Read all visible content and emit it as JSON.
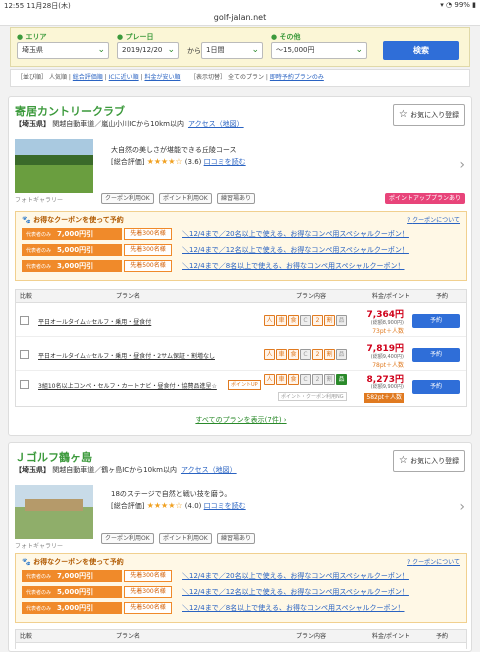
{
  "status": {
    "time": "12:55",
    "date": "11月28日(木)",
    "battery": "99%"
  },
  "url": "golf-jalan.net",
  "search": {
    "area_label": "エリア",
    "area_value": "埼玉県",
    "date_label": "プレー日",
    "date_value": "2019/12/20",
    "kara": "から",
    "days_value": "1日間",
    "other_label": "その他",
    "other_value": "〜15,000円",
    "search_button": "検索"
  },
  "sort": {
    "prefix": "［並び順］",
    "current": "人気順",
    "options": [
      "総合評価順",
      "ICに近い順",
      "料金が安い順"
    ],
    "display_prefix": "［表示切替］",
    "display_current": "全てのプラン",
    "display_link": "即時予約プランのみ"
  },
  "course1": {
    "name": "寄居カントリークラブ",
    "pref": "【埼玉県】",
    "access": "関越自動車道／嵐山小川ICから10km以内",
    "access_link": "アクセス（地図）",
    "fav": "お気に入り登録",
    "photo_label": "フォトギャラリー",
    "desc": "大自然の美しさが堪能できる丘陵コース",
    "rating_label": "[総合評価]",
    "stars": "★★★★☆",
    "score": "(3.6)",
    "review_link": "口コミを読む",
    "tags": [
      "クーポン利用OK",
      "ポイント利用OK",
      "練習場あり"
    ],
    "pointup": "ポイントアッププランあり",
    "coupon_head": "お得なクーポンを使って予約",
    "coupon_about": "クーポンについて",
    "coupons": [
      {
        "label": "代表者のみ",
        "amount": "7,000円引",
        "limit": "先着300名様",
        "link": "＼12/4まで／20名以上で使える、お得なコンペ用スペシャルクーポン！"
      },
      {
        "label": "代表者のみ",
        "amount": "5,000円引",
        "limit": "先着300名様",
        "link": "＼12/4まで／12名以上で使える、お得なコンペ用スペシャルクーポン！"
      },
      {
        "label": "代表者のみ",
        "amount": "3,000円引",
        "limit": "先着500名様",
        "link": "＼12/4まで／8名以上で使える、お得なコンペ用スペシャルクーポン！"
      }
    ],
    "table_head": {
      "compare": "比較",
      "plan": "プラン名",
      "content": "プラン内容",
      "price": "料金/ポイント",
      "reserve": "予約"
    },
    "plans": [
      {
        "name": "平日オールタイム☆セルフ・乗用・昼食付",
        "price": "7,364円",
        "sub": "(総額8,900円)",
        "pts": "73pt＋人数",
        "btn": "予約"
      },
      {
        "name": "平日オールタイム☆セルフ・乗用・昼食付・2サム保証・割増なし",
        "price": "7,819円",
        "sub": "(総額9,400円)",
        "pts": "78pt＋人数",
        "btn": "予約"
      },
      {
        "name": "3組10名以上コンペ・セルフ・カートナビ・昼食付・協賛品進呈☆",
        "badge": "ポイントUP",
        "point_only": "ポイント・クーポン利用NG",
        "price": "8,273円",
        "sub": "(総額9,900円)",
        "pts": "582pt＋人数",
        "btn": "予約"
      }
    ],
    "all_plans": "すべてのプランを表示(7件)"
  },
  "course2": {
    "name": "Ｊゴルフ鶴ヶ島",
    "pref": "【埼玉県】",
    "access": "関越自動車道／鶴ヶ島ICから10km以内",
    "access_link": "アクセス（地図）",
    "fav": "お気に入り登録",
    "photo_label": "フォトギャラリー",
    "desc": "18のステージで自然と戦い技を磨う。",
    "rating_label": "[総合評価]",
    "stars": "★★★★☆",
    "score": "(4.0)",
    "review_link": "口コミを読む",
    "tags": [
      "クーポン利用OK",
      "ポイント利用OK",
      "練習場あり"
    ],
    "coupon_head": "お得なクーポンを使って予約",
    "coupon_about": "クーポンについて",
    "coupons": [
      {
        "label": "代表者のみ",
        "amount": "7,000円引",
        "limit": "先着300名様",
        "link": "＼12/4まで／20名以上で使える、お得なコンペ用スペシャルクーポン！"
      },
      {
        "label": "代表者のみ",
        "amount": "5,000円引",
        "limit": "先着300名様",
        "link": "＼12/4まで／12名以上で使える、お得なコンペ用スペシャルクーポン！"
      },
      {
        "label": "代表者のみ",
        "amount": "3,000円引",
        "limit": "先着500名様",
        "link": "＼12/4まで／8名以上で使える、お得なコンペ用スペシャルクーポン！"
      }
    ],
    "table_head": {
      "compare": "比較",
      "plan": "プラン名",
      "content": "プラン内容",
      "price": "料金/ポイント",
      "reserve": "予約"
    }
  }
}
